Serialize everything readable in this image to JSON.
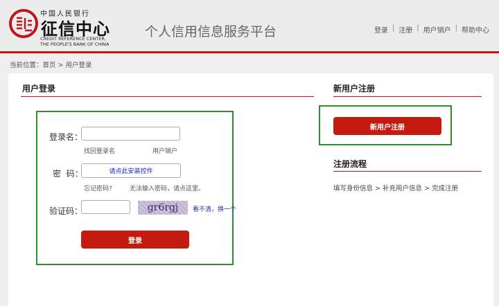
{
  "header": {
    "logo_top": "中国人民银行",
    "logo_main": "征信中心",
    "logo_en_1": "CREDIT REFERENCE CENTER,",
    "logo_en_2": "THE PEOPLE'S BANK OF CHINA",
    "platform_title": "个人信用信息服务平台",
    "nav": [
      "登录",
      "注册",
      "用户销户",
      "帮助中心"
    ],
    "separator": "|"
  },
  "breadcrumb": "当前位置：首页 > 用户登录",
  "login": {
    "title": "用户登录",
    "username_label": "登录名：",
    "find_username": "找回登录名",
    "cancel_account": "用户销户",
    "password_label": "密  码：",
    "password_placeholder": "请点此安装控件",
    "forgot_password": "忘记密码?",
    "cannot_input": "无法输入密码，请点这里。",
    "captcha_label": "验证码：",
    "captcha_text": "gr6rgj",
    "refresh_captcha": "看不清，换一个",
    "submit": "登录"
  },
  "register": {
    "title": "新用户注册",
    "button": "新用户注册",
    "flow_title": "注册流程",
    "flow_text": "填写身份信息 > 补充用户信息 > 完成注册"
  }
}
